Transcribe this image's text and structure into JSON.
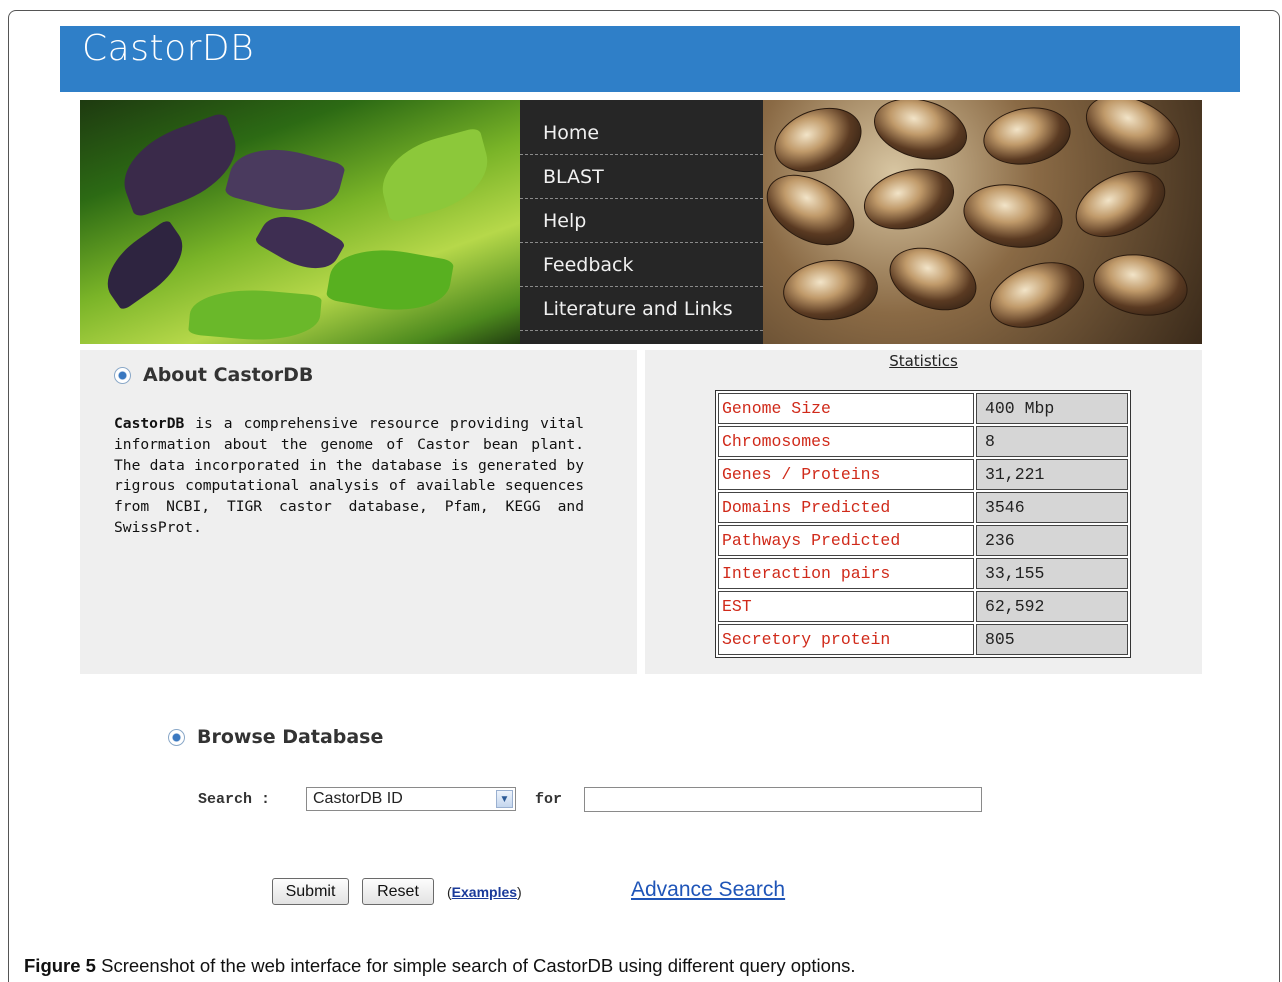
{
  "header": {
    "logo": "CastorDB"
  },
  "nav": {
    "items": [
      "Home",
      "BLAST",
      "Help",
      "Feedback",
      "Literature and Links"
    ]
  },
  "about": {
    "heading": "About CastorDB",
    "lead": "CastorDB",
    "body": " is a comprehensive resource providing vital information about the genome of Castor bean plant. The data incorporated in the database is generated by rigrous computational analysis of available sequences from NCBI, TIGR castor database, Pfam, KEGG and SwissProt."
  },
  "statistics": {
    "title": "Statistics",
    "rows": [
      {
        "label": "Genome Size",
        "value": "400 Mbp"
      },
      {
        "label": "Chromosomes",
        "value": "8"
      },
      {
        "label": "Genes / Proteins",
        "value": "31,221"
      },
      {
        "label": "Domains Predicted",
        "value": "3546"
      },
      {
        "label": "Pathways Predicted",
        "value": "236"
      },
      {
        "label": "Interaction pairs",
        "value": "33,155"
      },
      {
        "label": "EST",
        "value": "62,592"
      },
      {
        "label": "Secretory protein",
        "value": "805"
      }
    ]
  },
  "browse": {
    "heading": "Browse Database",
    "search_label": "Search :",
    "select_value": "CastorDB ID",
    "for_label": "for",
    "input_value": "",
    "submit_label": "Submit",
    "reset_label": "Reset",
    "examples_open": "(",
    "examples_label": "Examples",
    "examples_close": ")",
    "advance_label": "Advance Search"
  },
  "caption": {
    "bold": "Figure 5",
    "text": " Screenshot of the web interface for simple search of CastorDB using different query options."
  },
  "colors": {
    "header_bg": "#2f7fc8",
    "nav_bg": "#262626",
    "stat_label": "#d02a1a",
    "link": "#1f55b8"
  }
}
